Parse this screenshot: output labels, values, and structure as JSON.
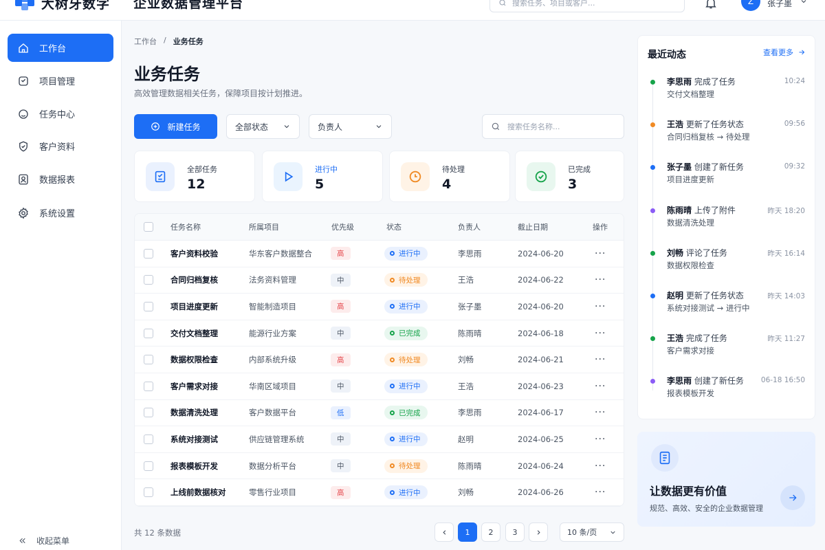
{
  "header": {
    "logo_text": "大树牙数字",
    "app_title": "企业数据管理平台",
    "search_placeholder": "搜索任务、项目或客户...",
    "avatar_initial": "Z",
    "username": "张子墨"
  },
  "sidebar": {
    "items": [
      {
        "label": "工作台",
        "icon": "home-icon"
      },
      {
        "label": "项目管理",
        "icon": "folder-icon"
      },
      {
        "label": "任务中心",
        "icon": "task-icon"
      },
      {
        "label": "客户资料",
        "icon": "shield-icon"
      },
      {
        "label": "数据报表",
        "icon": "user-icon"
      },
      {
        "label": "系统设置",
        "icon": "gear-icon"
      }
    ],
    "collapse_label": "收起菜单"
  },
  "breadcrumb": {
    "home": "工作台",
    "separator": "/",
    "current": "业务任务"
  },
  "page": {
    "title": "业务任务",
    "description": "高效管理数据相关任务，保障项目按计划推进。"
  },
  "toolbar": {
    "new_task_label": "新建任务",
    "status_filter": "全部状态",
    "owner_filter": "负责人",
    "search_placeholder": "搜索任务名称..."
  },
  "stats": [
    {
      "label": "全部任务",
      "value": "12",
      "color": "#1d6ef5"
    },
    {
      "label": "进行中",
      "value": "5",
      "color": "#1d6ef5"
    },
    {
      "label": "待处理",
      "value": "4",
      "color": "#f08a24"
    },
    {
      "label": "已完成",
      "value": "3",
      "color": "#16a34a"
    }
  ],
  "table": {
    "columns": [
      "任务名称",
      "所属项目",
      "优先级",
      "状态",
      "负责人",
      "截止日期",
      "操作"
    ],
    "rows": [
      {
        "name": "客户资料校验",
        "project": "华东客户数据整合",
        "priority": "高",
        "priority_level": "high",
        "status": "进行中",
        "status_type": "doing",
        "owner": "李思雨",
        "due": "2024-06-20"
      },
      {
        "name": "合同归档复核",
        "project": "法务资料管理",
        "priority": "中",
        "priority_level": "mid",
        "status": "待处理",
        "status_type": "pending",
        "owner": "王浩",
        "due": "2024-06-22"
      },
      {
        "name": "项目进度更新",
        "project": "智能制造项目",
        "priority": "高",
        "priority_level": "high",
        "status": "进行中",
        "status_type": "doing",
        "owner": "张子墨",
        "due": "2024-06-20"
      },
      {
        "name": "交付文档整理",
        "project": "能源行业方案",
        "priority": "中",
        "priority_level": "mid",
        "status": "已完成",
        "status_type": "done",
        "owner": "陈雨晴",
        "due": "2024-06-18"
      },
      {
        "name": "数据权限检查",
        "project": "内部系统升级",
        "priority": "高",
        "priority_level": "high",
        "status": "待处理",
        "status_type": "pending",
        "owner": "刘畅",
        "due": "2024-06-21"
      },
      {
        "name": "客户需求对接",
        "project": "华南区域项目",
        "priority": "中",
        "priority_level": "mid",
        "status": "进行中",
        "status_type": "doing",
        "owner": "王浩",
        "due": "2024-06-23"
      },
      {
        "name": "数据清洗处理",
        "project": "客户数据平台",
        "priority": "低",
        "priority_level": "low",
        "status": "已完成",
        "status_type": "done",
        "owner": "李思雨",
        "due": "2024-06-17"
      },
      {
        "name": "系统对接测试",
        "project": "供应链管理系统",
        "priority": "中",
        "priority_level": "mid",
        "status": "进行中",
        "status_type": "doing",
        "owner": "赵明",
        "due": "2024-06-25"
      },
      {
        "name": "报表模板开发",
        "project": "数据分析平台",
        "priority": "中",
        "priority_level": "mid",
        "status": "待处理",
        "status_type": "pending",
        "owner": "陈雨晴",
        "due": "2024-06-24"
      },
      {
        "name": "上线前数据核对",
        "project": "零售行业项目",
        "priority": "高",
        "priority_level": "high",
        "status": "进行中",
        "status_type": "doing",
        "owner": "刘畅",
        "due": "2024-06-26"
      }
    ],
    "more_label": "···"
  },
  "footer": {
    "total_text": "共 12 条数据",
    "pages": [
      "1",
      "2",
      "3"
    ],
    "page_size": "10 条/页"
  },
  "activity": {
    "title": "最近动态",
    "view_more": "查看更多",
    "items": [
      {
        "user": "李思雨",
        "action": "完成了任务",
        "detail": "交付文档整理",
        "time": "10:24",
        "color": "#16a34a"
      },
      {
        "user": "王浩",
        "action": "更新了任务状态",
        "detail": "合同归档复核 → 待处理",
        "time": "09:56",
        "color": "#f08a24"
      },
      {
        "user": "张子墨",
        "action": "创建了新任务",
        "detail": "项目进度更新",
        "time": "09:32",
        "color": "#1d6ef5"
      },
      {
        "user": "陈雨晴",
        "action": "上传了附件",
        "detail": "数据清洗处理",
        "time": "昨天 18:20",
        "color": "#8b5cf6"
      },
      {
        "user": "刘畅",
        "action": "评论了任务",
        "detail": "数据权限检查",
        "time": "昨天 16:14",
        "color": "#16a34a"
      },
      {
        "user": "赵明",
        "action": "更新了任务状态",
        "detail": "系统对接测试 → 进行中",
        "time": "昨天 14:03",
        "color": "#1d6ef5"
      },
      {
        "user": "王浩",
        "action": "完成了任务",
        "detail": "客户需求对接",
        "time": "昨天 11:27",
        "color": "#16a34a"
      },
      {
        "user": "李思雨",
        "action": "创建了新任务",
        "detail": "报表模板开发",
        "time": "06-18 16:50",
        "color": "#8b5cf6"
      }
    ]
  },
  "promo": {
    "title": "让数据更有价值",
    "description": "规范、高效、安全的企业数据管理"
  }
}
